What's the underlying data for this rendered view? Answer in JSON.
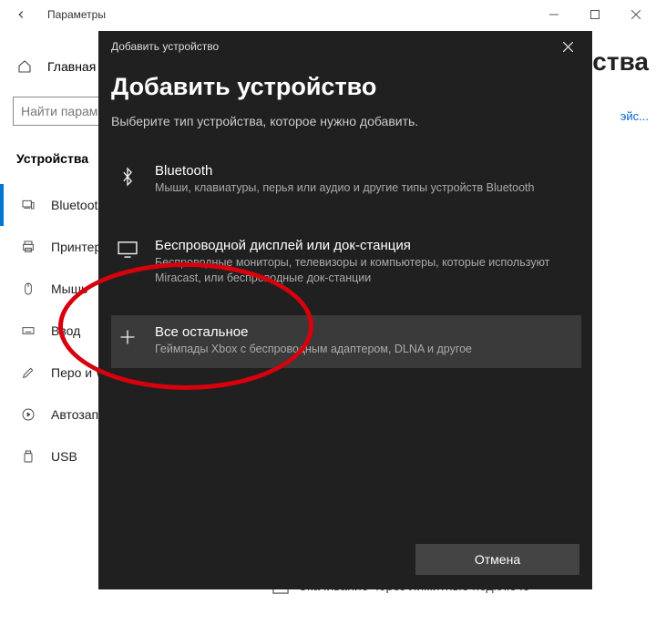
{
  "window": {
    "title": "Параметры",
    "home_label": "Главная",
    "search_placeholder": "Найти парам",
    "section_label": "Устройства",
    "nav": [
      {
        "id": "bluetooth",
        "label": "Bluetooth",
        "selected": true
      },
      {
        "id": "printers",
        "label": "Принтеры"
      },
      {
        "id": "mouse",
        "label": "Мышь"
      },
      {
        "id": "typing",
        "label": "Ввод"
      },
      {
        "id": "pen",
        "label": "Перо и W"
      },
      {
        "id": "autoplay",
        "label": "Автозапу"
      },
      {
        "id": "usb",
        "label": "USB"
      }
    ],
    "right_title_tail": "йства",
    "right_link_tail": "эйс...",
    "download_metered": "Скачивание через лимитные подключе"
  },
  "modal": {
    "titlebar": "Добавить устройство",
    "heading": "Добавить устройство",
    "sub": "Выберите тип устройства, которое нужно добавить.",
    "options": [
      {
        "id": "bluetooth",
        "title": "Bluetooth",
        "desc": "Мыши, клавиатуры, перья или аудио и другие типы устройств Bluetooth"
      },
      {
        "id": "wireless-display",
        "title": "Беспроводной дисплей или док-станция",
        "desc": "Беспроводные мониторы, телевизоры и компьютеры, которые используют Miracast, или беспроводные док-станции"
      },
      {
        "id": "other",
        "title": "Все остальное",
        "desc": "Геймпады Xbox с беспроводным адаптером, DLNA и другое",
        "highlight": true
      }
    ],
    "cancel": "Отмена"
  }
}
